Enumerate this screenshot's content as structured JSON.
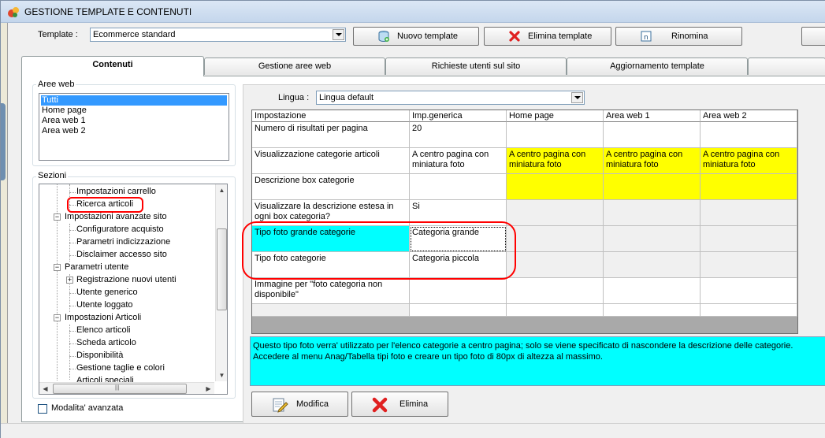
{
  "window": {
    "title": "GESTIONE TEMPLATE E CONTENUTI"
  },
  "toolbar": {
    "template_label": "Template :",
    "template_value": "Ecommerce standard",
    "new_label": "Nuovo template",
    "delete_label": "Elimina template",
    "rename_label": "Rinomina"
  },
  "tabs": [
    {
      "label": "Contenuti",
      "active": true
    },
    {
      "label": "Gestione aree web"
    },
    {
      "label": "Richieste utenti sul sito"
    },
    {
      "label": "Aggiornamento template"
    }
  ],
  "aree_web": {
    "label": "Aree web",
    "items": [
      {
        "label": "Tutti",
        "selected": true
      },
      {
        "label": "Home page"
      },
      {
        "label": "Area web 1"
      },
      {
        "label": "Area web 2"
      }
    ]
  },
  "sezioni": {
    "label": "Sezioni",
    "tree": [
      {
        "label": "Impostazioni carrello"
      },
      {
        "label": "Ricerca articoli"
      },
      {
        "label": "Impostazioni avanzate sito"
      },
      {
        "label": "Configuratore acquisto"
      },
      {
        "label": "Parametri indicizzazione"
      },
      {
        "label": "Disclaimer accesso sito"
      },
      {
        "label": "Parametri utente"
      },
      {
        "label": "Registrazione nuovi utenti"
      },
      {
        "label": "Utente generico"
      },
      {
        "label": "Utente loggato"
      },
      {
        "label": "Impostazioni Articoli"
      },
      {
        "label": "Elenco articoli"
      },
      {
        "label": "Scheda articolo"
      },
      {
        "label": "Disponibilità"
      },
      {
        "label": "Gestione taglie e colori"
      },
      {
        "label": "Articoli speciali"
      }
    ]
  },
  "advanced_mode": {
    "label": "Modalita' avanzata",
    "checked": false
  },
  "lingua": {
    "label": "Lingua :",
    "value": "Lingua default"
  },
  "grid": {
    "headers": [
      "Impostazione",
      "Imp.generica",
      "Home page",
      "Area web 1",
      "Area web 2"
    ],
    "rows": [
      [
        "Numero di risultati per pagina",
        "20",
        "",
        "",
        ""
      ],
      [
        "Visualizzazione categorie articoli",
        "A centro pagina con miniatura foto",
        "A centro pagina con miniatura foto",
        "A centro pagina con miniatura foto",
        "A centro pagina con miniatura foto"
      ],
      [
        "Descrizione box categorie",
        "",
        "",
        "",
        ""
      ],
      [
        "Visualizzare la descrizione estesa in ogni box categoria?",
        "Si",
        "",
        "",
        ""
      ],
      [
        "Tipo foto grande categorie",
        "Categoria grande",
        "",
        "",
        ""
      ],
      [
        "Tipo foto categorie",
        "Categoria piccola",
        "",
        "",
        ""
      ],
      [
        "Immagine per \"foto categoria non disponibile\"",
        "",
        "",
        "",
        ""
      ]
    ]
  },
  "description": {
    "line1": "Questo tipo foto verra' utilizzato per l'elenco categorie a centro pagina; solo se viene specificato di nascondere la descrizione delle categorie.",
    "line2": "Accedere al menu Anag/Tabella tipi foto e creare un tipo foto di 80px di altezza al massimo."
  },
  "actions": {
    "modify_label": "Modifica",
    "delete_label": "Elimina"
  },
  "colors": {
    "highlight_yellow": "#ffff00",
    "highlight_cyan": "#00ffff",
    "selection_blue": "#3399ff",
    "annotation_red": "#ff0000"
  }
}
